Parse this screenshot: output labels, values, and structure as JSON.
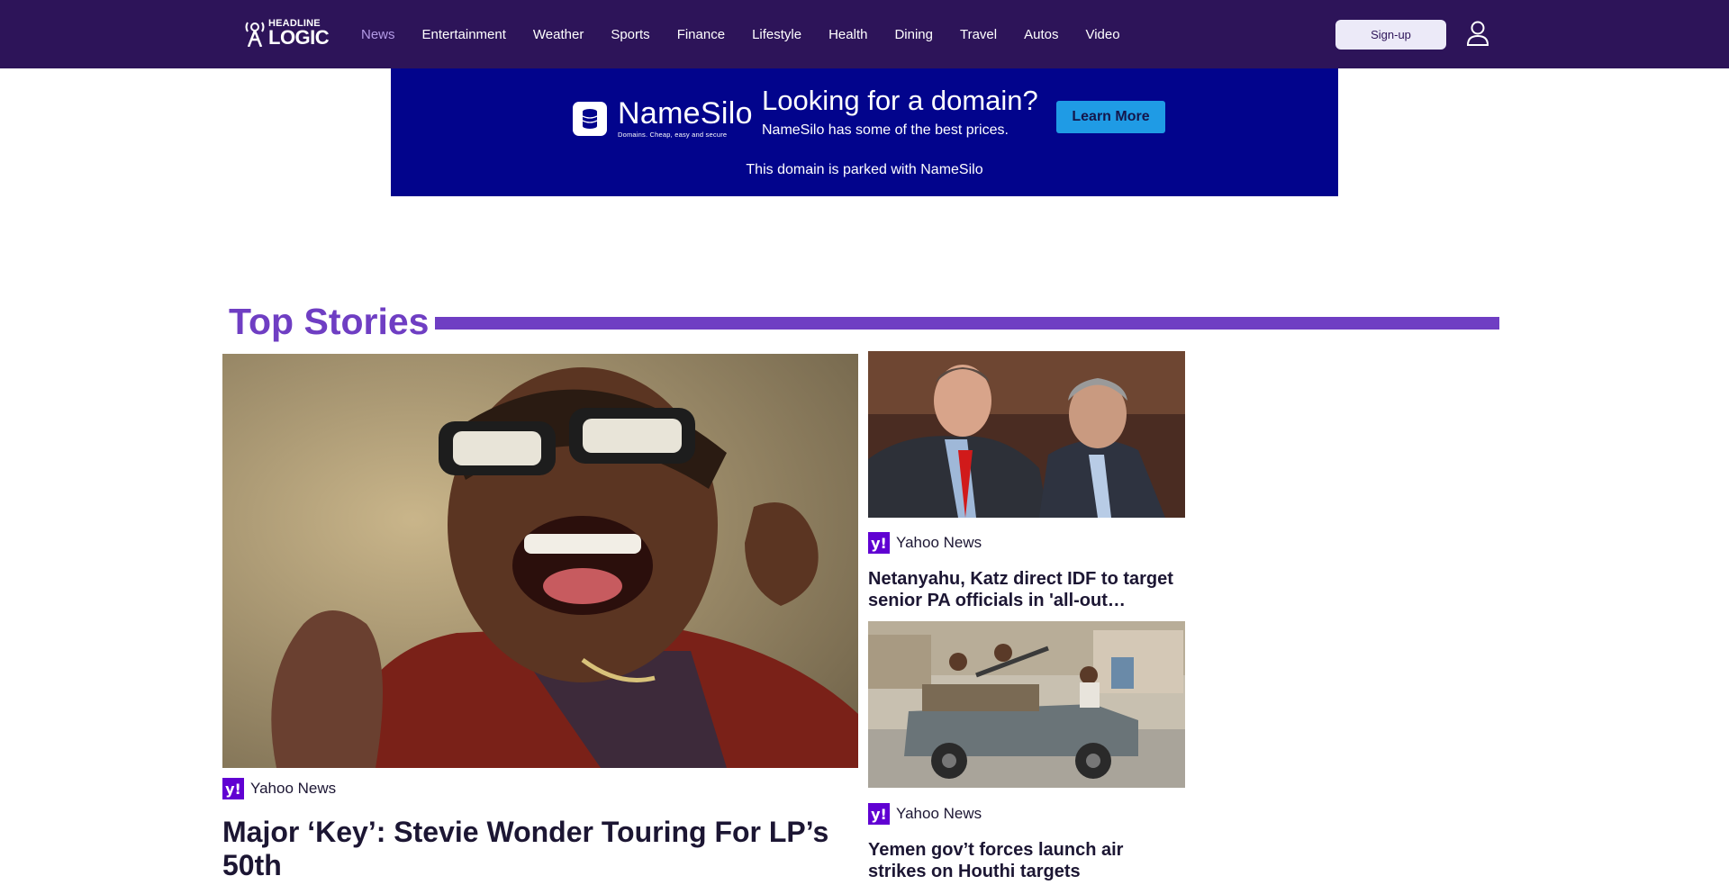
{
  "header": {
    "logo": {
      "line1": "HEADLINE",
      "line2": "LOGIC"
    },
    "nav": [
      {
        "label": "News",
        "active": true
      },
      {
        "label": "Entertainment"
      },
      {
        "label": "Weather"
      },
      {
        "label": "Sports"
      },
      {
        "label": "Finance"
      },
      {
        "label": "Lifestyle"
      },
      {
        "label": "Health"
      },
      {
        "label": "Dining"
      },
      {
        "label": "Travel"
      },
      {
        "label": "Autos"
      },
      {
        "label": "Video"
      }
    ],
    "signup_label": "Sign-up",
    "user_icon": "user-icon"
  },
  "ad": {
    "brand": "NameSilo",
    "tagline": "Domains. Cheap, easy and secure",
    "headline": "Looking for a domain?",
    "subtext": "NameSilo has some of the best prices.",
    "button_label": "Learn More",
    "footer": "This domain is parked with NameSilo"
  },
  "top_stories": {
    "title": "Top Stories",
    "stories": [
      {
        "source": "Yahoo News",
        "headline": "Major ‘Key’: Stevie Wonder Touring For LP’s 50th",
        "image": "photo-singer-sunglasses"
      },
      {
        "source": "Yahoo News",
        "headline": "Netanyahu, Katz direct IDF to target senior PA officials in 'all-out response'",
        "image": "photo-parliament-officials"
      },
      {
        "source": "Yahoo News",
        "headline": "Yemen gov’t forces launch air strikes on Houthi targets",
        "image": "photo-armed-pickup-truck"
      }
    ]
  },
  "colors": {
    "topbar": "#2d1459",
    "nav_active": "#b39ae6",
    "ad_background": "#02048c",
    "ad_button": "#1f9be5",
    "accent": "#6f3ec3",
    "source_icon": "#6001d2"
  }
}
